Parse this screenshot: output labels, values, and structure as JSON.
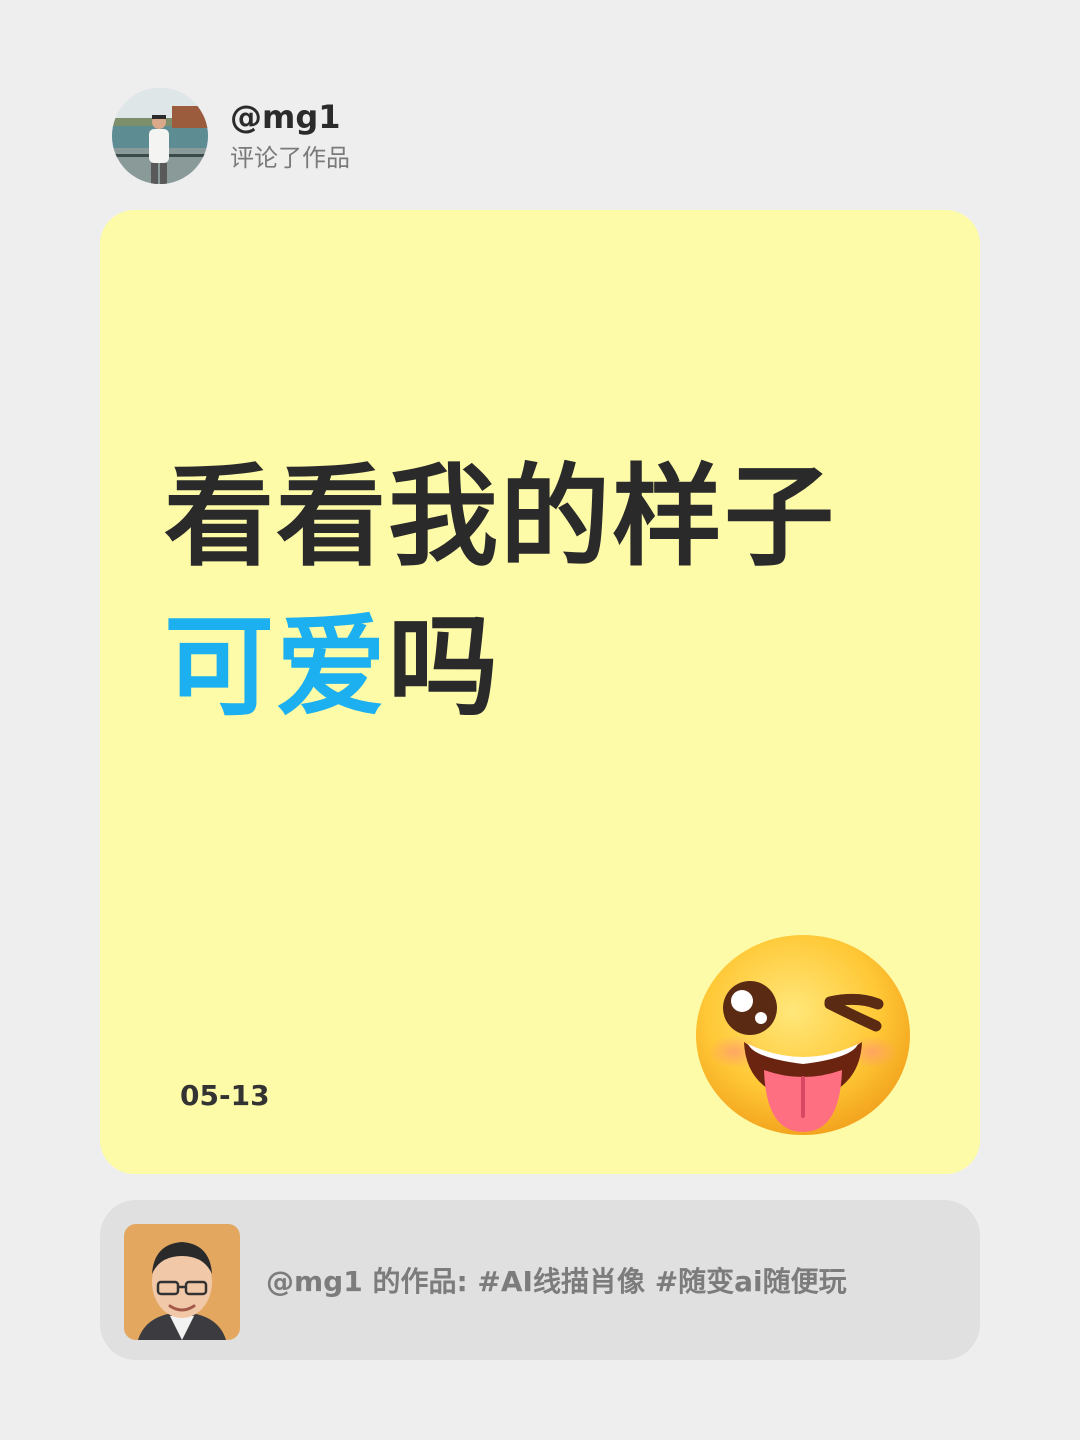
{
  "author": {
    "username": "@mg1",
    "action": "评论了作品",
    "avatar_icon": "user-photo-avatar"
  },
  "card": {
    "background": "#fefba8",
    "headline_line1": "看看我的样子",
    "headline_line2_accent": "可爱",
    "headline_line2_rest": "吗",
    "accent_color": "#1cb0f0",
    "date": "05-13",
    "emoji_icon": "winking-face-with-tongue-emoji"
  },
  "work": {
    "caption": "@mg1  的作品: #AI线描肖像 #随变ai随便玩",
    "thumb_icon": "portrait-thumbnail"
  }
}
